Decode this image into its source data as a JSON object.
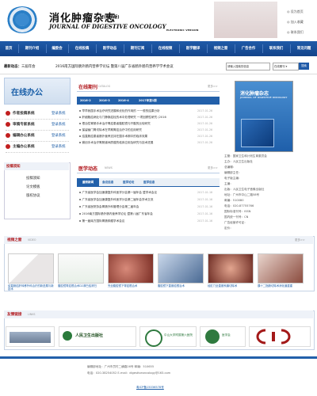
{
  "header": {
    "title_cn": "消化肿瘤杂志",
    "title_tag": "(电子版)",
    "title_en": "JOURNAL OF DIGESTIVE ONCOLOGY",
    "title_ev": "ELECTRONIC VERSION",
    "links": [
      "◎ 设为首页",
      "◎ 加入收藏",
      "◎ 联系我们"
    ]
  },
  "nav": [
    "首页",
    "期刊介绍",
    "编委会",
    "在线投稿",
    "医学动态",
    "期刊订阅",
    "在线视频",
    "医学翻译",
    "视频之窗",
    "广告合作",
    "联系我们",
    "常见问题"
  ],
  "ticker": {
    "label": "最新动态：",
    "items": [
      "三届年会",
      "2016南方国际肠外肠内营养学论坛 暨第八届广东省肠外肠内营养学学术会议"
    ]
  },
  "search": {
    "placeholder": "请输入搜索的信息",
    "select": "在线期刊",
    "button": "搜索"
  },
  "left": {
    "online_office": "在线办公",
    "systems": [
      {
        "label": "作者投稿系统",
        "action": "登录系统"
      },
      {
        "label": "审稿专家系统",
        "action": "登录系统"
      },
      {
        "label": "编辑办公系统",
        "action": "登录系统"
      },
      {
        "label": "主编办公系统",
        "action": "登录系统"
      }
    ],
    "guide_title": "投稿须知",
    "guide_items": [
      "投稿须知",
      "论文模板",
      "版权协议"
    ]
  },
  "catalog": {
    "title": "在线期刊",
    "subtitle": "CATALOG",
    "more": "更多>>",
    "tabs": [
      "2016-2",
      "2016-3",
      "2016-4",
      "2017年第1期"
    ],
    "items": [
      {
        "title": "早早我国手术治疗研究进展和优化的作用的 一一般的结果分析",
        "date": "2017-01-26"
      },
      {
        "title": "肝细胞癌病灶与门静脉癌栓的术中处理研究 一项回顾性研究 (2016",
        "date": "2017-01-26"
      },
      {
        "title": "根治性胃肠手术治疗胃癌患者腹腔镜与开腹的比较研究",
        "date": "2017-01-26"
      },
      {
        "title": "保留幽门胃切除术在早期胃癌治疗中的应用研究",
        "date": "2017-01-26"
      },
      {
        "title": "结直肠癌患者肠外营养支持在围手术期中的临床效果",
        "date": "2017-01-26"
      },
      {
        "title": "微创手术治疗胃肠道间质瘤的临床应用及研究与技术进展",
        "date": "2017-01-26"
      }
    ]
  },
  "news": {
    "title": "医学动态",
    "subtitle": "NEWS",
    "more": "更多>>",
    "tabs": [
      "重磅新闻",
      "会议信息",
      "医学论坛",
      "医学信息"
    ],
    "items": [
      {
        "title": "广东省医学会加速康复外科医学分会第一届年会 暨学术会议",
        "date": "2017-01-16"
      },
      {
        "title": "广东省医学会加速康复外科医学分会第二届年会学术交流",
        "date": "2017-01-16"
      },
      {
        "title": "广东省医院协会胃肠外科管理分会第二届年会",
        "date": "2017-01-16"
      },
      {
        "title": "2016南方国际肠外肠内营养学论坛 暨第八届广东省年会",
        "date": "2017-01-16"
      },
      {
        "title": "第一届南方国际胃肠肿瘤学术会议",
        "date": "2017-01-16"
      }
    ]
  },
  "cover": {
    "title": "消化肿瘤杂志",
    "subtitle": "JOURNAL OF DIGESTIVE ONCOLOGY"
  },
  "journal_info": [
    "主管：国家卫生和计划生育委员会",
    "主办：人民卫生出版社",
    "总编辑：",
    "编辑部主任：",
    "电子版主编：",
    "主编：",
    "出版：人民卫生电子音像出版社",
    "地址：广州市中山二路58号",
    "邮编：510080",
    "电话：020-87755766",
    "国际标准刊号：ISSN",
    "国内统一刊号：CN",
    "广告经营许可证：",
    "定价：",
    "出版日期："
  ],
  "videos": {
    "title": "视频之窗",
    "subtitle": "VIDEO",
    "more": "更多>>",
    "items": [
      "结直肠癌肝转移外科治疗的新进展与新技术",
      "腹腔镜胃癌根治术D2淋巴结清扫",
      "完全腹腔镜下胃癌根治术",
      "腹腔镜下直肠癌根治术",
      "经肛门全直肠系膜切除术",
      "胰十二指肠切除术消化道重建"
    ]
  },
  "links": {
    "title": "友情链接",
    "subtitle": "LINKS",
    "items": [
      "人民卫生出版社",
      "中山大学附属第六医院",
      "医学会",
      "中国医师协会"
    ]
  },
  "footer": {
    "lines": [
      "编辑部地址：广州市员村二横路26号    邮编：510655",
      "电话：020-38254052   E-mail：digestiveoncology@163.com"
    ],
    "icp": "粤ICP备15036578号"
  }
}
